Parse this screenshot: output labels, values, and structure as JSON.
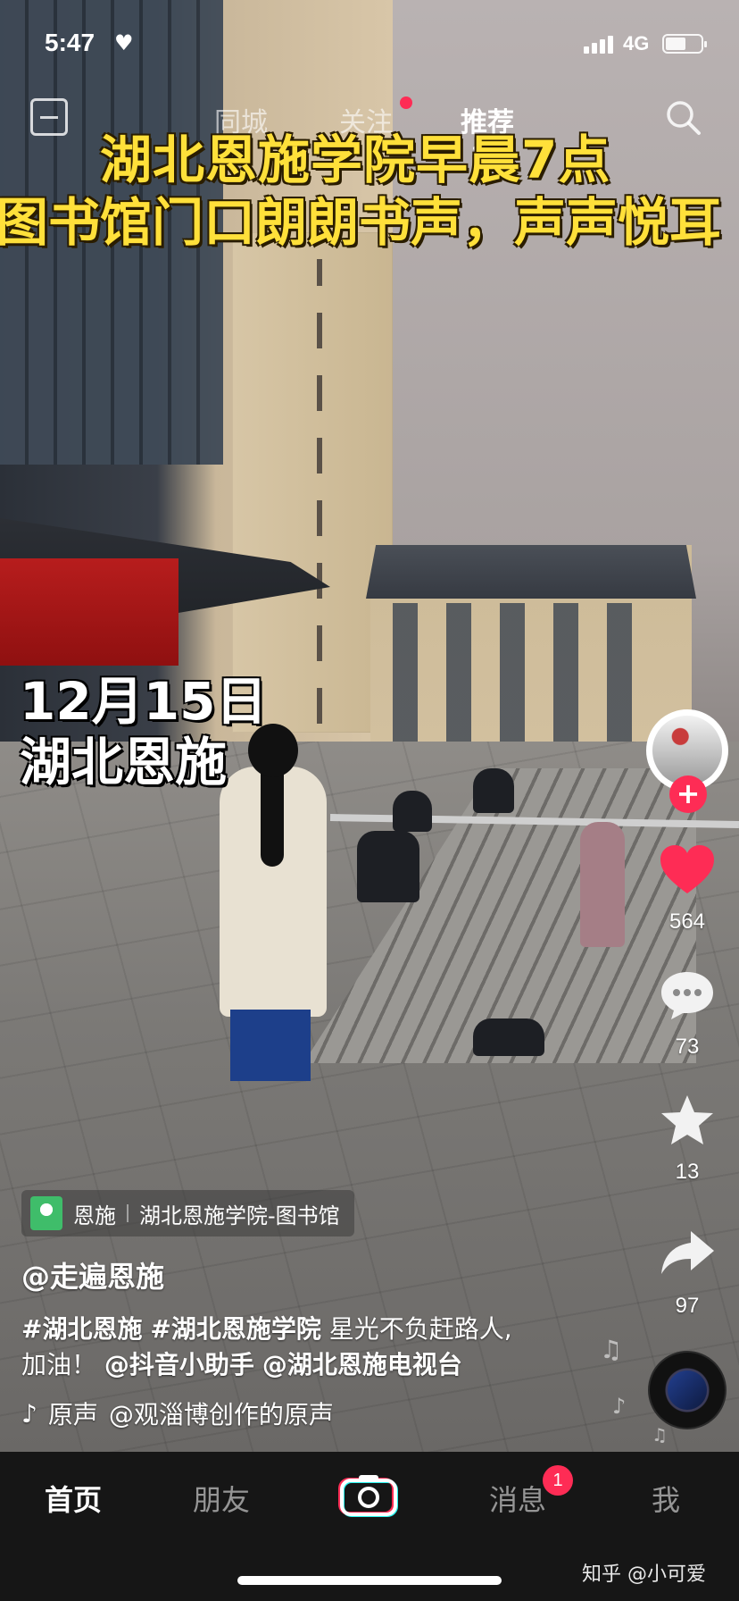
{
  "status_bar": {
    "time": "5:47",
    "network": "4G"
  },
  "top_tabs": [
    {
      "label": "同城",
      "active": false
    },
    {
      "label": "关注",
      "active": false,
      "has_dot": true
    },
    {
      "label": "推荐",
      "active": true
    }
  ],
  "video_captions": {
    "line1": "湖北恩施学院早晨7点",
    "line2": "图书馆门口朗朗书声，声声悦耳",
    "date": "12月15日",
    "place": "湖北恩施"
  },
  "actions": {
    "likes": "564",
    "comments": "73",
    "favorites": "13",
    "shares": "97"
  },
  "location": {
    "city": "恩施",
    "venue": "湖北恩施学院-图书馆"
  },
  "author": "@走遍恩施",
  "description": {
    "tag1": "#湖北恩施",
    "tag2": "#湖北恩施学院",
    "text1": "星光不负赶路人,",
    "text2": "加油！",
    "mention1": "@抖音小助手",
    "mention2": "@湖北恩施电视台"
  },
  "music": {
    "label": "原声",
    "author": "@观淄博创作的原声"
  },
  "bottom_nav": [
    {
      "label": "首页",
      "active": true
    },
    {
      "label": "朋友",
      "active": false
    },
    {
      "label": "消息",
      "active": false,
      "badge": "1"
    },
    {
      "label": "我",
      "active": false
    }
  ],
  "watermark": "知乎 @小可爱",
  "colors": {
    "accent": "#fe2c55",
    "caption_yellow": "#ffe03a",
    "tabbar_bg": "#161616"
  },
  "icons": [
    "scan-icon",
    "search-icon",
    "heart-icon",
    "comment-icon",
    "star-icon",
    "share-icon",
    "camera-icon",
    "music-note-icon",
    "location-pin-icon"
  ]
}
